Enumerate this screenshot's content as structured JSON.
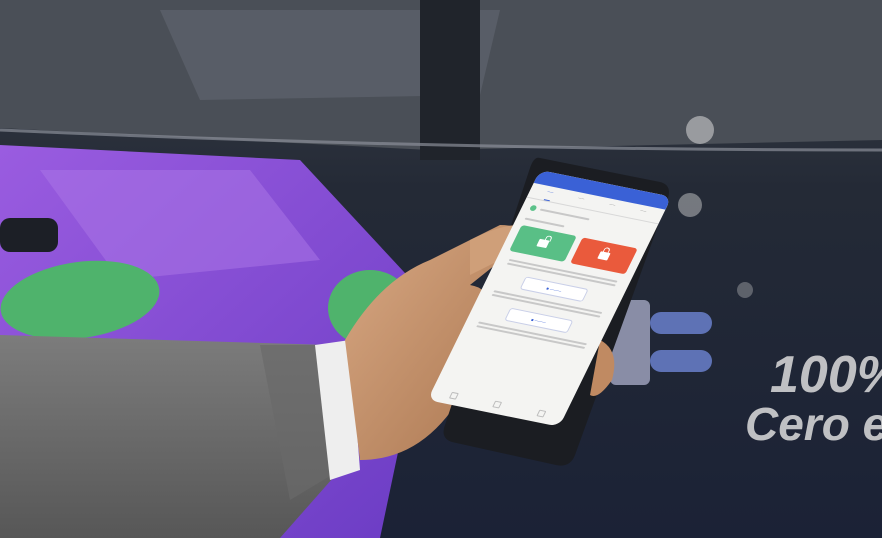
{
  "scene": {
    "description": "Hand holding a smartphone showing a vehicle lock/unlock app in front of a dark car with purple and green graphics",
    "colors": {
      "car_dark": "#1e2740",
      "car_purple": "#8a4fd6",
      "car_green": "#4fb36c",
      "sleeve": "#6f6f6f",
      "skin": "#c9986f",
      "phone_body": "#1b1d22",
      "app_blue": "#3a61d6",
      "unlock_green": "#59bf86",
      "lock_red": "#ea5a3c"
    }
  },
  "car_text": {
    "line1": "100%",
    "line2": "Cero e"
  },
  "phone": {
    "icons": [
      "unlock-icon",
      "lock-icon"
    ]
  }
}
